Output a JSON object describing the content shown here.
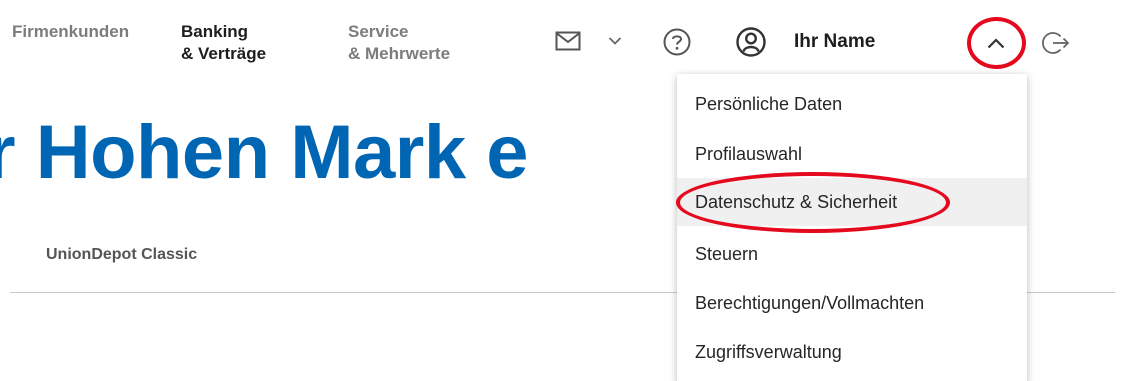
{
  "nav": {
    "firmenkunden": "Firmenkunden",
    "banking_line1": "Banking",
    "banking_line2": "& Verträge",
    "service_line1": "Service",
    "service_line2": "& Mehrwerte"
  },
  "header": {
    "user_name": "Ihr Name",
    "icons": [
      "mail-icon",
      "chevron-down-icon",
      "help-icon",
      "user-icon",
      "chevron-up-icon",
      "logout-icon"
    ]
  },
  "page": {
    "bank_title_partial": "r Hohen Mark e",
    "subnav_item": "UnionDepot Classic"
  },
  "profile_menu": {
    "items": [
      "Persönliche Daten",
      "Profilauswahl",
      "Datenschutz & Sicherheit",
      "Steuern",
      "Berechtigungen/Vollmachten",
      "Zugriffsverwaltung"
    ],
    "highlighted_item": "Datenschutz & Sicherheit"
  },
  "colors": {
    "brand_blue": "#0066b3",
    "annotation_red": "#e5091e",
    "hover_gray": "#f0f0f0"
  }
}
